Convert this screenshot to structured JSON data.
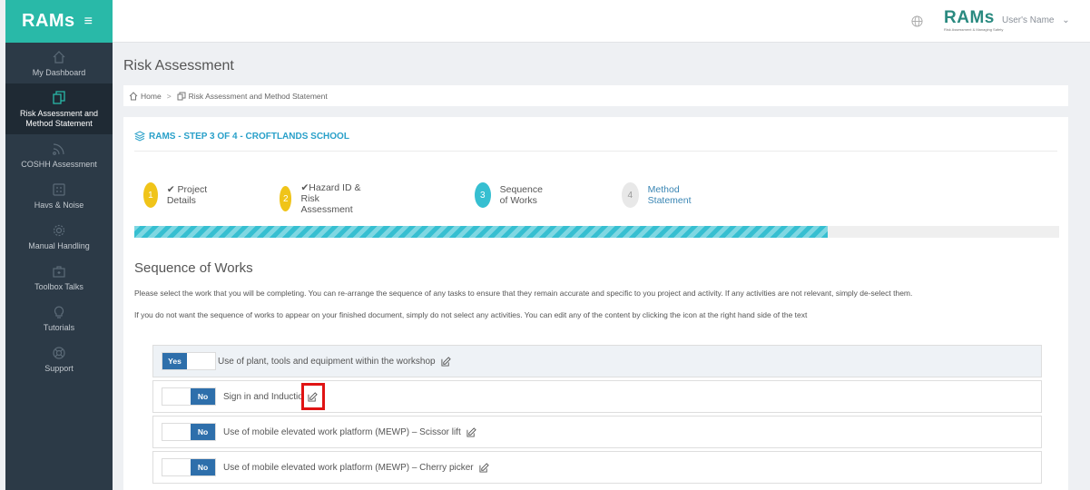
{
  "sidebar": {
    "brand": "RAMs",
    "menu_glyph": "≡",
    "items": [
      {
        "label": "My Dashboard",
        "icon": "home-icon",
        "active": false
      },
      {
        "label": "Risk Assessment and Method Statement",
        "icon": "documents-icon",
        "active": true
      },
      {
        "label": "COSHH Assessment",
        "icon": "rss-icon",
        "active": false
      },
      {
        "label": "Havs & Noise",
        "icon": "calculator-icon",
        "active": false
      },
      {
        "label": "Manual Handling",
        "icon": "gear-icon",
        "active": false
      },
      {
        "label": "Toolbox Talks",
        "icon": "toolbox-icon",
        "active": false
      },
      {
        "label": "Tutorials",
        "icon": "lightbulb-icon",
        "active": false
      },
      {
        "label": "Support",
        "icon": "lifebuoy-icon",
        "active": false
      }
    ]
  },
  "header": {
    "logo": "RAMs",
    "logo_sub": "Risk Assessment & Managing Safety",
    "user_name": "User's Name",
    "user_chevron": "⌄"
  },
  "page": {
    "title": "Risk Assessment",
    "breadcrumb": {
      "home": "Home",
      "sep": ">",
      "current": "Risk Assessment and Method Statement"
    }
  },
  "card": {
    "step_title": "RAMS - STEP 3 OF 4 - CROFTLANDS SCHOOL",
    "wizard": [
      {
        "num": "1",
        "label": "✔ Project Details"
      },
      {
        "num": "2",
        "label": "✔Hazard ID & Risk Assessment"
      },
      {
        "num": "3",
        "label": "Sequence of Works"
      },
      {
        "num": "4",
        "label": "Method Statement"
      }
    ],
    "progress_percent": 75,
    "section_title": "Sequence of Works",
    "paragraph1": "Please select the work that you will be completing. You can re-arrange the sequence of any tasks to ensure that they remain accurate and specific to you project and activity. If any activities are not relevant, simply de-select them.",
    "paragraph2": "If you do not want the sequence of works to appear on your finished document, simply do not select any activities. You can edit any of the content by clicking the icon at the right hand side of the text",
    "rows": [
      {
        "toggle": "Yes",
        "label": "Use of plant, tools and equipment within the workshop"
      },
      {
        "toggle": "No",
        "label": "Sign in and Inductio"
      },
      {
        "toggle": "No",
        "label": "Use of mobile elevated work platform (MEWP) – Scissor lift"
      },
      {
        "toggle": "No",
        "label": "Use of mobile elevated work platform (MEWP) – Cherry picker"
      }
    ]
  },
  "colors": {
    "brand": "#29b9a8",
    "sidebar": "#2c3a47",
    "toggle": "#2e6fab",
    "step_yellow": "#f0c419",
    "step_teal": "#36bfd1",
    "highlight": "#e01414"
  }
}
